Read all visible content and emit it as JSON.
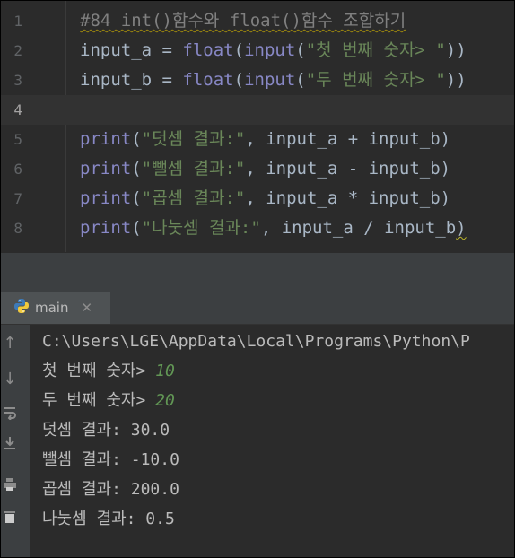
{
  "editor": {
    "lines": [
      {
        "num": "1",
        "comment": "#84 int()함수와 float()함수 조합하기"
      },
      {
        "num": "2",
        "var": "input_a",
        "eq": " = ",
        "fn1": "float",
        "p1": "(",
        "fn2": "input",
        "p2": "(",
        "str": "\"첫 번째 숫자> \"",
        "close": "))"
      },
      {
        "num": "3",
        "var": "input_b",
        "eq": " = ",
        "fn1": "float",
        "p1": "(",
        "fn2": "input",
        "p2": "(",
        "str": "\"두 번째 숫자> \"",
        "close": "))"
      },
      {
        "num": "4"
      },
      {
        "num": "5",
        "fn": "print",
        "p": "(",
        "str": "\"덧셈 결과:\"",
        "rest": ", input_a + input_b)"
      },
      {
        "num": "6",
        "fn": "print",
        "p": "(",
        "str": "\"뺄셈 결과:\"",
        "rest": ", input_a - input_b)"
      },
      {
        "num": "7",
        "fn": "print",
        "p": "(",
        "str": "\"곱셈 결과:\"",
        "rest": ", input_a * input_b)"
      },
      {
        "num": "8",
        "fn": "print",
        "p": "(",
        "str": "\"나눗셈 결과:\"",
        "rest": ", input_a / input_b",
        "last": ")"
      }
    ]
  },
  "run": {
    "tab_label": "main",
    "close_glyph": "✕",
    "console": [
      {
        "text": "C:\\Users\\LGE\\AppData\\Local\\Programs\\Python\\P"
      },
      {
        "prompt": "첫 번째 숫자> ",
        "value": "10"
      },
      {
        "prompt": "두 번째 숫자> ",
        "value": "20"
      },
      {
        "text": "덧셈 결과: 30.0"
      },
      {
        "text": "뺄셈 결과: -10.0"
      },
      {
        "text": "곱셈 결과: 200.0"
      },
      {
        "text": "나눗셈 결과: 0.5"
      }
    ]
  },
  "icons": {
    "python": "python-icon",
    "tools": [
      "up-arrow-icon",
      "down-arrow-icon",
      "soft-wrap-icon",
      "scroll-to-end-icon",
      "print-icon",
      "trash-icon"
    ]
  },
  "colors": {
    "editor_bg": "#2b2b2b",
    "comment": "#808080",
    "keyword": "#8888c6",
    "string": "#6a8759",
    "text": "#a9b7c6",
    "input_value": "#629755"
  }
}
